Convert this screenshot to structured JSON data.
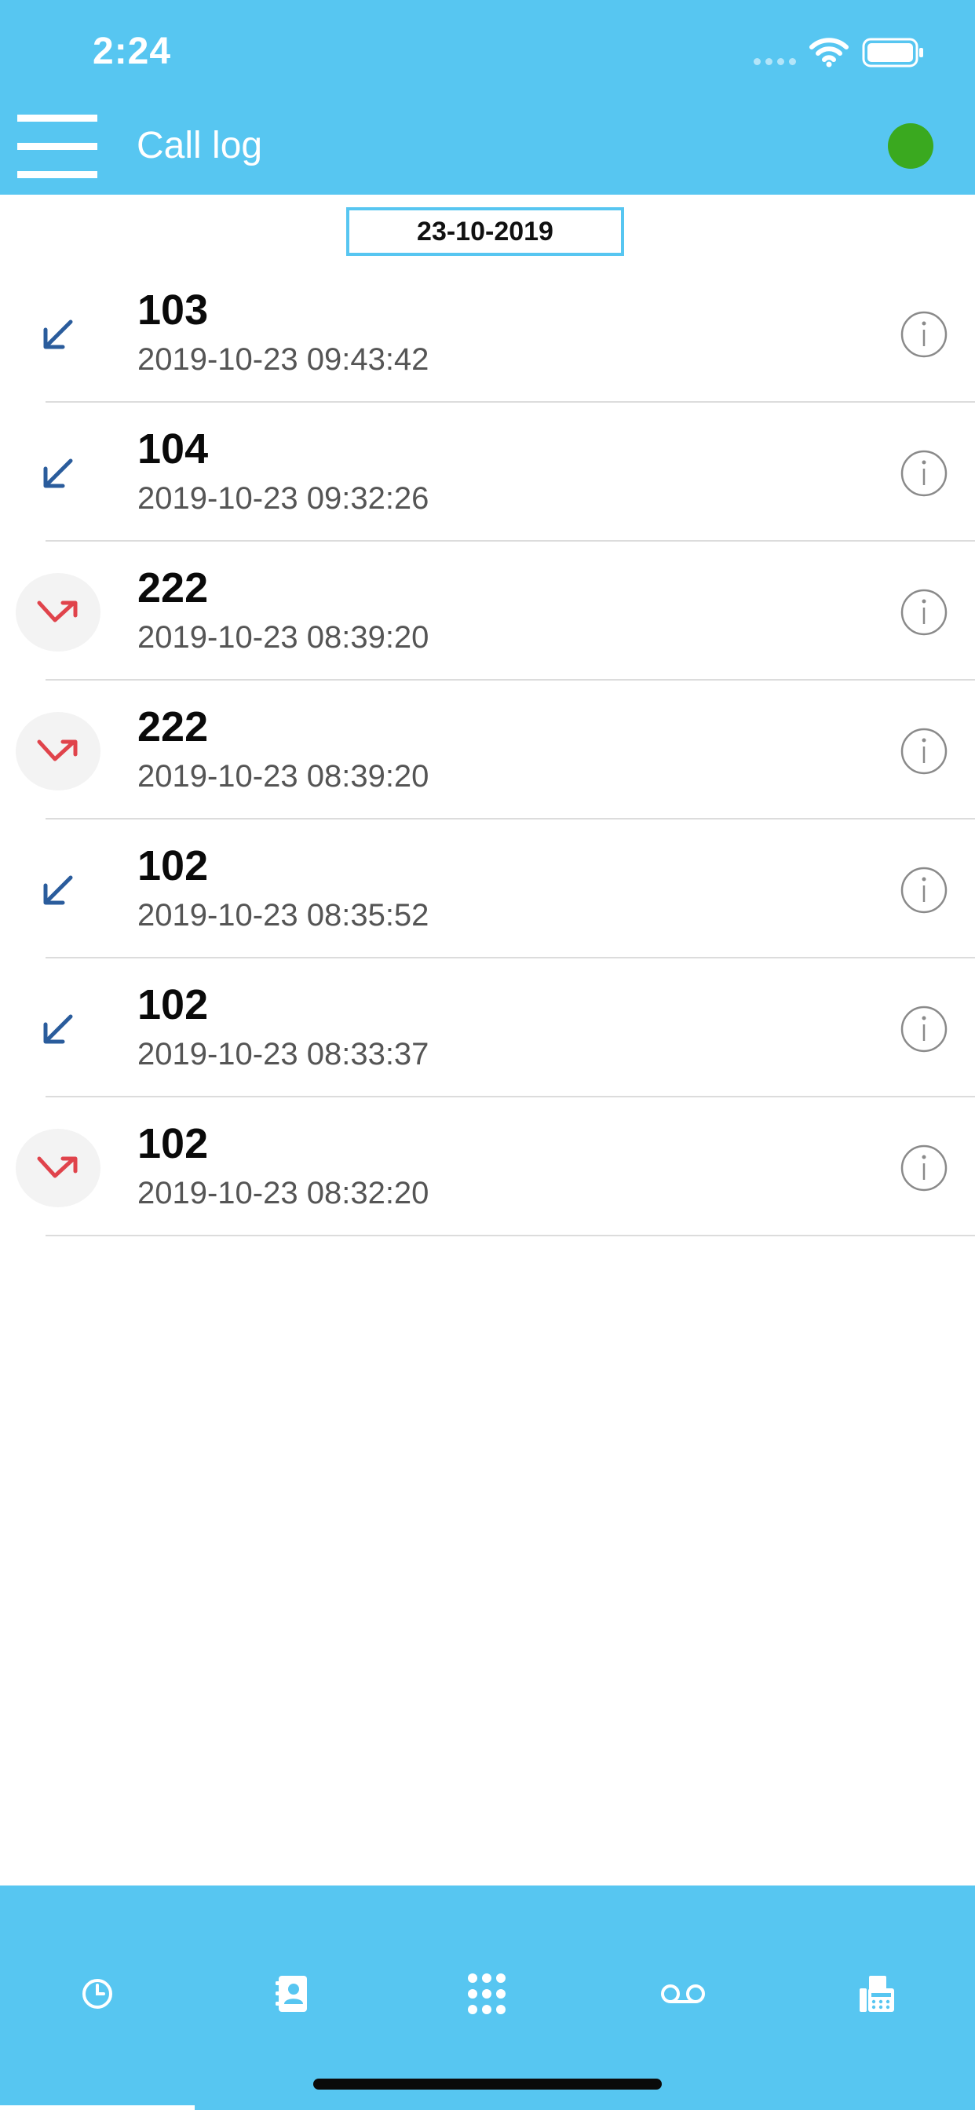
{
  "status_bar": {
    "time": "2:24"
  },
  "header": {
    "title": "Call log",
    "presence_color": "#3aa91f"
  },
  "date_filter": {
    "value": "23-10-2019"
  },
  "calls": [
    {
      "number": "103",
      "datetime": "2019-10-23 09:43:42",
      "direction": "incoming"
    },
    {
      "number": "104",
      "datetime": "2019-10-23 09:32:26",
      "direction": "incoming"
    },
    {
      "number": "222",
      "datetime": "2019-10-23 08:39:20",
      "direction": "missed"
    },
    {
      "number": "222",
      "datetime": "2019-10-23 08:39:20",
      "direction": "missed"
    },
    {
      "number": "102",
      "datetime": "2019-10-23 08:35:52",
      "direction": "incoming"
    },
    {
      "number": "102",
      "datetime": "2019-10-23 08:33:37",
      "direction": "incoming"
    },
    {
      "number": "102",
      "datetime": "2019-10-23 08:32:20",
      "direction": "missed"
    }
  ],
  "colors": {
    "accent": "#57c6f1",
    "incoming_arrow": "#2a5c9c",
    "missed_arrow": "#e0434b"
  },
  "tabs": [
    {
      "icon": "clock-icon"
    },
    {
      "icon": "contacts-icon"
    },
    {
      "icon": "dialpad-icon"
    },
    {
      "icon": "voicemail-icon"
    },
    {
      "icon": "fax-icon"
    }
  ]
}
